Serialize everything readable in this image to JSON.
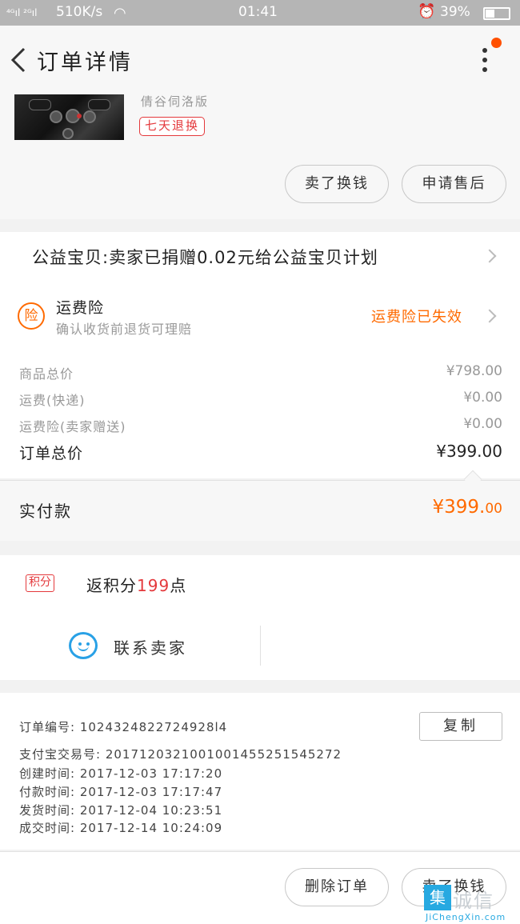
{
  "status_bar": {
    "signal": "⁴ᴳıl ²ᴳıl",
    "speed": "510K/s",
    "time": "01:41",
    "battery": "39%"
  },
  "nav": {
    "title": "订单详情"
  },
  "product": {
    "spec": "倩谷伺洛版",
    "badge": "七天退换",
    "buttons": [
      "卖了换钱",
      "申请售后"
    ]
  },
  "charity": {
    "text": "公益宝贝:卖家已捐赠0.02元给公益宝贝计划"
  },
  "insurance": {
    "icon_char": "险",
    "title": "运费险",
    "desc": "确认收货前退货可理赔",
    "status": "运费险已失效"
  },
  "fees": [
    {
      "label": "商品总价",
      "value": "¥798.00"
    },
    {
      "label": "运费(快递)",
      "value": "¥0.00"
    },
    {
      "label": "运费险(卖家赠送)",
      "value": "¥0.00"
    }
  ],
  "total": {
    "label": "订单总价",
    "value": "¥399.00"
  },
  "paid": {
    "label": "实付款",
    "amount_main": "¥399.",
    "amount_cents": "00"
  },
  "points": {
    "badge": "积分",
    "prefix": "返积分",
    "count": "199",
    "suffix": "点"
  },
  "contact": {
    "label": "联系卖家"
  },
  "order_info": {
    "copy_label": "复制",
    "lines": [
      "订单编号:  1024324822724928l4",
      "支付宝交易号:  2017120321001001455251545272",
      "创建时间:  2017-12-03  17:17:20",
      "付款时间:  2017-12-03  17:17:47",
      "发货时间:  2017-12-04  10:23:51",
      "成交时间:  2017-12-14  10:24:09"
    ]
  },
  "bottom_actions": [
    "删除订单",
    "卖了换钱"
  ],
  "watermark": {
    "box": "集",
    "text": "诚信",
    "url": "JiChengXin.com"
  },
  "colors": {
    "accent": "#ff6a00",
    "red": "#e4393c",
    "blue": "#29a1e6"
  }
}
